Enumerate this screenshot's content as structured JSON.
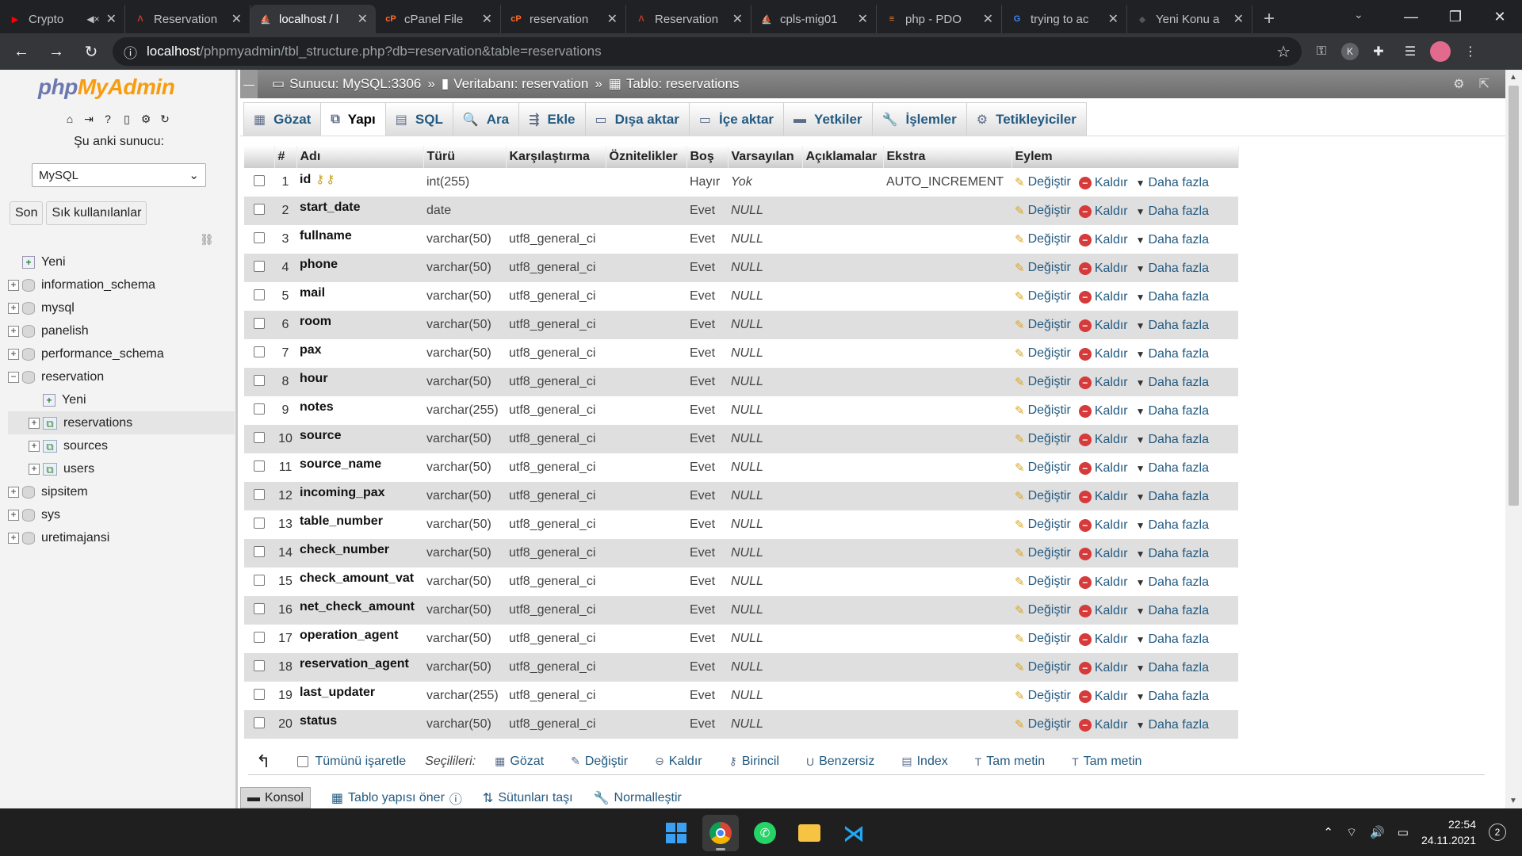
{
  "browser": {
    "tabs": [
      {
        "title": "Crypto",
        "color": "#ff0000",
        "glyph": "▶",
        "muted": true,
        "active": false
      },
      {
        "title": "Reservation",
        "color": "#c0392b",
        "glyph": "Λ",
        "muted": false,
        "active": false
      },
      {
        "title": "localhost / l",
        "color": "#f89c0e",
        "glyph": "⛵",
        "muted": false,
        "active": true
      },
      {
        "title": "cPanel File",
        "color": "#ff6c2c",
        "glyph": "cP",
        "muted": false,
        "active": false
      },
      {
        "title": "reservation",
        "color": "#ff6c2c",
        "glyph": "cP",
        "muted": false,
        "active": false
      },
      {
        "title": "Reservation",
        "color": "#c0392b",
        "glyph": "Λ",
        "muted": false,
        "active": false
      },
      {
        "title": "cpls-mig01",
        "color": "#f89c0e",
        "glyph": "⛵",
        "muted": false,
        "active": false
      },
      {
        "title": "php - PDO",
        "color": "#f48024",
        "glyph": "≡",
        "muted": false,
        "active": false
      },
      {
        "title": "trying to ac",
        "color": "#4285f4",
        "glyph": "G",
        "muted": false,
        "active": false
      },
      {
        "title": "Yeni Konu a",
        "color": "#555555",
        "glyph": "◆",
        "muted": false,
        "active": false
      }
    ],
    "url_host": "localhost",
    "url_path": "/phpmyadmin/tbl_structure.php?db=reservation&table=reservations",
    "profile_letter": "K"
  },
  "nav": {
    "logo_php": "php",
    "logo_myadmin": "MyAdmin",
    "server_label": "Şu anki sunucu:",
    "server_value": "MySQL",
    "btn_recent": "Son",
    "btn_favorites": "Sık kullanılanlar",
    "tree": [
      {
        "label": "Yeni",
        "type": "new",
        "level": 0,
        "exp": ""
      },
      {
        "label": "information_schema",
        "type": "db",
        "level": 0,
        "exp": "+"
      },
      {
        "label": "mysql",
        "type": "db",
        "level": 0,
        "exp": "+"
      },
      {
        "label": "panelish",
        "type": "db",
        "level": 0,
        "exp": "+"
      },
      {
        "label": "performance_schema",
        "type": "db",
        "level": 0,
        "exp": "+"
      },
      {
        "label": "reservation",
        "type": "db",
        "level": 0,
        "exp": "−"
      },
      {
        "label": "Yeni",
        "type": "new",
        "level": 1,
        "exp": ""
      },
      {
        "label": "reservations",
        "type": "table",
        "level": 1,
        "exp": "+",
        "selected": true
      },
      {
        "label": "sources",
        "type": "table",
        "level": 1,
        "exp": "+"
      },
      {
        "label": "users",
        "type": "table",
        "level": 1,
        "exp": "+"
      },
      {
        "label": "sipsitem",
        "type": "db",
        "level": 0,
        "exp": "+"
      },
      {
        "label": "sys",
        "type": "db",
        "level": 0,
        "exp": "+"
      },
      {
        "label": "uretimajansi",
        "type": "db",
        "level": 0,
        "exp": "+"
      }
    ]
  },
  "breadcrumb": {
    "server": "Sunucu: MySQL:3306",
    "database": "Veritabanı: reservation",
    "table": "Tablo: reservations"
  },
  "menu": [
    {
      "label": "Gözat",
      "icon": "▦",
      "active": false
    },
    {
      "label": "Yapı",
      "icon": "⧉",
      "active": true
    },
    {
      "label": "SQL",
      "icon": "▤",
      "active": false
    },
    {
      "label": "Ara",
      "icon": "🔍",
      "active": false
    },
    {
      "label": "Ekle",
      "icon": "⇶",
      "active": false
    },
    {
      "label": "Dışa aktar",
      "icon": "▭",
      "active": false
    },
    {
      "label": "İçe aktar",
      "icon": "▭",
      "active": false
    },
    {
      "label": "Yetkiler",
      "icon": "▬",
      "active": false
    },
    {
      "label": "İşlemler",
      "icon": "🔧",
      "active": false
    },
    {
      "label": "Tetikleyiciler",
      "icon": "⚙",
      "active": false
    }
  ],
  "table": {
    "headers": [
      "#",
      "Adı",
      "Türü",
      "Karşılaştırma",
      "Öznitelikler",
      "Boş",
      "Varsayılan",
      "Açıklamalar",
      "Ekstra",
      "Eylem"
    ],
    "actions": {
      "change": "Değiştir",
      "drop": "Kaldır",
      "more": "Daha fazla"
    },
    "rows": [
      {
        "n": "1",
        "name": "id",
        "type": "int(255)",
        "coll": "",
        "attr": "",
        "null": "Hayır",
        "def": "Yok",
        "comm": "",
        "extra": "AUTO_INCREMENT",
        "key": true
      },
      {
        "n": "2",
        "name": "start_date",
        "type": "date",
        "coll": "",
        "attr": "",
        "null": "Evet",
        "def": "NULL",
        "comm": "",
        "extra": ""
      },
      {
        "n": "3",
        "name": "fullname",
        "type": "varchar(50)",
        "coll": "utf8_general_ci",
        "attr": "",
        "null": "Evet",
        "def": "NULL",
        "comm": "",
        "extra": ""
      },
      {
        "n": "4",
        "name": "phone",
        "type": "varchar(50)",
        "coll": "utf8_general_ci",
        "attr": "",
        "null": "Evet",
        "def": "NULL",
        "comm": "",
        "extra": ""
      },
      {
        "n": "5",
        "name": "mail",
        "type": "varchar(50)",
        "coll": "utf8_general_ci",
        "attr": "",
        "null": "Evet",
        "def": "NULL",
        "comm": "",
        "extra": ""
      },
      {
        "n": "6",
        "name": "room",
        "type": "varchar(50)",
        "coll": "utf8_general_ci",
        "attr": "",
        "null": "Evet",
        "def": "NULL",
        "comm": "",
        "extra": ""
      },
      {
        "n": "7",
        "name": "pax",
        "type": "varchar(50)",
        "coll": "utf8_general_ci",
        "attr": "",
        "null": "Evet",
        "def": "NULL",
        "comm": "",
        "extra": ""
      },
      {
        "n": "8",
        "name": "hour",
        "type": "varchar(50)",
        "coll": "utf8_general_ci",
        "attr": "",
        "null": "Evet",
        "def": "NULL",
        "comm": "",
        "extra": ""
      },
      {
        "n": "9",
        "name": "notes",
        "type": "varchar(255)",
        "coll": "utf8_general_ci",
        "attr": "",
        "null": "Evet",
        "def": "NULL",
        "comm": "",
        "extra": ""
      },
      {
        "n": "10",
        "name": "source",
        "type": "varchar(50)",
        "coll": "utf8_general_ci",
        "attr": "",
        "null": "Evet",
        "def": "NULL",
        "comm": "",
        "extra": ""
      },
      {
        "n": "11",
        "name": "source_name",
        "type": "varchar(50)",
        "coll": "utf8_general_ci",
        "attr": "",
        "null": "Evet",
        "def": "NULL",
        "comm": "",
        "extra": ""
      },
      {
        "n": "12",
        "name": "incoming_pax",
        "type": "varchar(50)",
        "coll": "utf8_general_ci",
        "attr": "",
        "null": "Evet",
        "def": "NULL",
        "comm": "",
        "extra": ""
      },
      {
        "n": "13",
        "name": "table_number",
        "type": "varchar(50)",
        "coll": "utf8_general_ci",
        "attr": "",
        "null": "Evet",
        "def": "NULL",
        "comm": "",
        "extra": ""
      },
      {
        "n": "14",
        "name": "check_number",
        "type": "varchar(50)",
        "coll": "utf8_general_ci",
        "attr": "",
        "null": "Evet",
        "def": "NULL",
        "comm": "",
        "extra": ""
      },
      {
        "n": "15",
        "name": "check_amount_vat",
        "type": "varchar(50)",
        "coll": "utf8_general_ci",
        "attr": "",
        "null": "Evet",
        "def": "NULL",
        "comm": "",
        "extra": ""
      },
      {
        "n": "16",
        "name": "net_check_amount",
        "type": "varchar(50)",
        "coll": "utf8_general_ci",
        "attr": "",
        "null": "Evet",
        "def": "NULL",
        "comm": "",
        "extra": ""
      },
      {
        "n": "17",
        "name": "operation_agent",
        "type": "varchar(50)",
        "coll": "utf8_general_ci",
        "attr": "",
        "null": "Evet",
        "def": "NULL",
        "comm": "",
        "extra": ""
      },
      {
        "n": "18",
        "name": "reservation_agent",
        "type": "varchar(50)",
        "coll": "utf8_general_ci",
        "attr": "",
        "null": "Evet",
        "def": "NULL",
        "comm": "",
        "extra": ""
      },
      {
        "n": "19",
        "name": "last_updater",
        "type": "varchar(255)",
        "coll": "utf8_general_ci",
        "attr": "",
        "null": "Evet",
        "def": "NULL",
        "comm": "",
        "extra": ""
      },
      {
        "n": "20",
        "name": "status",
        "type": "varchar(50)",
        "coll": "utf8_general_ci",
        "attr": "",
        "null": "Evet",
        "def": "NULL",
        "comm": "",
        "extra": ""
      }
    ]
  },
  "bulk": {
    "check_all": "Tümünü işaretle",
    "with_selected": "Seçilileri:",
    "actions": [
      {
        "label": "Gözat",
        "icon": "▦"
      },
      {
        "label": "Değiştir",
        "icon": "✎"
      },
      {
        "label": "Kaldır",
        "icon": "⊖"
      },
      {
        "label": "Birincil",
        "icon": "⚷"
      },
      {
        "label": "Benzersiz",
        "icon": "U"
      },
      {
        "label": "Index",
        "icon": "▤"
      },
      {
        "label": "Tam metin",
        "icon": "T"
      },
      {
        "label": "Tam metin",
        "icon": "T"
      }
    ]
  },
  "bottom": {
    "console": "Konsol",
    "suggest": "Tablo yapısı öner",
    "move_columns": "Sütunları taşı",
    "normalize": "Normalleştir"
  },
  "taskbar": {
    "time": "22:54",
    "date": "24.11.2021",
    "notifications": "2"
  }
}
